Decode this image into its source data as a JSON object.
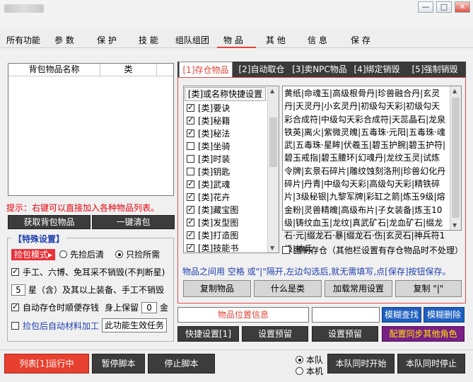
{
  "menu": {
    "items": [
      "所有功能",
      "参 数",
      "保 护",
      "技 能",
      "组队组团",
      "物 品",
      "其 他",
      "信 息",
      "保 存"
    ],
    "active_index": 5
  },
  "window": {
    "min_label": "—",
    "max_label": "□",
    "close_label": "✕"
  },
  "left": {
    "list_headers": [
      "背包物品名称",
      "类"
    ],
    "hint": "提示：右键可以直接加入各种物品列表。",
    "get_button": "获取背包物品",
    "clean_button": "一键清包",
    "special": {
      "title": "【特殊设置】",
      "pick_mode": "捡包模式",
      "radio_first": "先捡后清",
      "radio_only": "只捡所需",
      "cb_hand": "手工、六博、免耳采不销毁(不判断星)",
      "star_value": "5",
      "star_text": "星（含）及其以上装备、手工不销毁",
      "cb_auto": "自动存仓时顺便存钱",
      "keep_label": "身上保留",
      "keep_value": "0",
      "gold": "金",
      "cb_material": "捡包后自动材料加工",
      "effective_button": "此功能生效任务"
    }
  },
  "right": {
    "tabs": [
      "[1]存仓物品",
      "[2]自动取仓",
      "[3]卖NPC物品",
      "[4]绑定销毁",
      "[5]强制销毁"
    ],
    "active_tab": 0,
    "category_header": "[类]或名称快捷设置",
    "categories": [
      {
        "label": "[类]要诀",
        "checked": true
      },
      {
        "label": "[类]秘籍",
        "checked": true
      },
      {
        "label": "[类]秘法",
        "checked": true
      },
      {
        "label": "[类]坐骑",
        "checked": false
      },
      {
        "label": "[类]时装",
        "checked": false
      },
      {
        "label": "[类]钥匙",
        "checked": false
      },
      {
        "label": "[类]武魂",
        "checked": true
      },
      {
        "label": "[类]花卉",
        "checked": true
      },
      {
        "label": "[类]藏宝图",
        "checked": true
      },
      {
        "label": "[类]发型图",
        "checked": true
      },
      {
        "label": "[类]打造图",
        "checked": true
      },
      {
        "label": "[类]技能书",
        "checked": true
      }
    ],
    "items_text": "黄纸|命魂玉|高级根骨丹|珍兽融合丹|玄灵丹|天灵丹|小玄灵丹|初级勾天彩|初级勾天彩合成符|中级勾天彩合成符|天蕊晶石|龙泉铁英|离火|紫微灵魄|五毒珠·元阳|五毒珠·魂武|五毒珠·星眸|伏羲玉|碧玉护腕|碧玉护符|碧玉戒指|碧玉腰环|幻魂丹|龙纹玉灵|试炼令牌|玄景石碎片|雕纹蚀刻洛刑|珍兽幻化丹碎片|丹青|中级勾天彩|高级勾天彩|精铁碎片|3级秘银|九黎军牌|彩缸之箭|炼玉9级|熔金粉|灵兽精魄|高级布片|子女装备|炼玉10级|铸纹血玉|龙纹|真武矿石|龙血矿石|缀龙石·元|缀龙石·暴|缀龙石·伤|玄灵石|神兵符1级|神兵",
    "force_store": "强制存仓（其他栏设置有存仓物品时不处理）",
    "note": "物品之间用 空格 或\"|\"隔开,左边勾选后,就无需填写,点[保存]按钮保存。",
    "buttons": [
      "复制物品",
      "什么是类",
      "加载常用设置",
      "复制 \"|\""
    ],
    "location_label": "物品位置信息",
    "fuzzy_find": "模糊查找",
    "fuzzy_delete": "模糊删除",
    "quick_settings": "快捷设置[1]",
    "preset1": "设置预留",
    "preset2": "设置预留",
    "sync_config": "配置同步其他角色"
  },
  "bottom": {
    "run_list": "列表[1]运行中",
    "pause": "暂停脚本",
    "stop": "停止脚本",
    "radio_team": "本队",
    "radio_machine": "本机",
    "team_start": "本队同时开始",
    "team_stop": "本队同时停止"
  }
}
